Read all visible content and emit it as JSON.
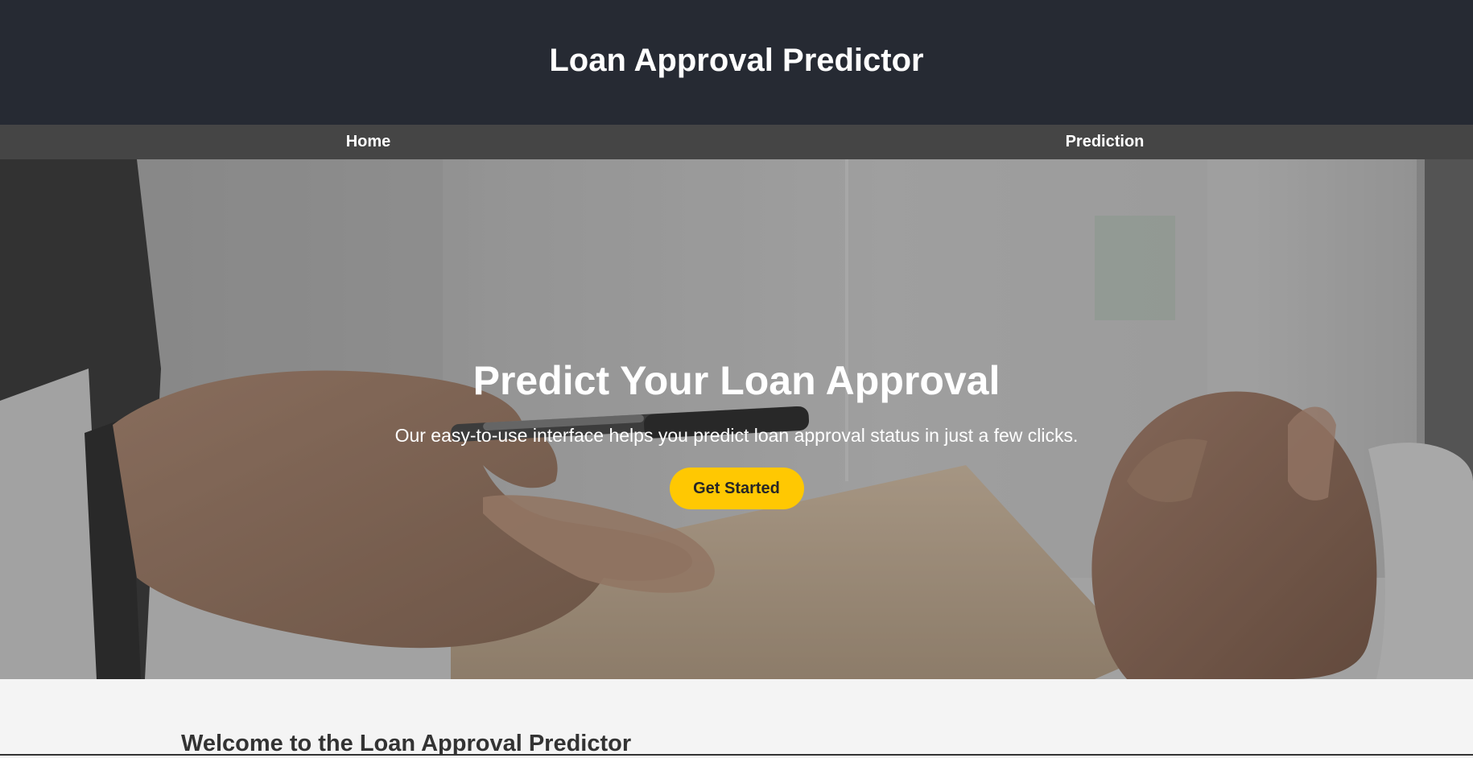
{
  "header": {
    "title": "Loan Approval Predictor"
  },
  "nav": {
    "items": [
      {
        "label": "Home"
      },
      {
        "label": "Prediction"
      }
    ]
  },
  "hero": {
    "heading": "Predict Your Loan Approval",
    "subtitle": "Our easy-to-use interface helps you predict loan approval status in just a few clicks.",
    "cta_label": "Get Started",
    "cta_color": "#ffc802"
  },
  "welcome": {
    "title": "Welcome to the Loan Approval Predictor"
  },
  "colors": {
    "header_bg": "#262a33",
    "nav_bg": "#454545",
    "page_bg": "#f4f4f4"
  }
}
